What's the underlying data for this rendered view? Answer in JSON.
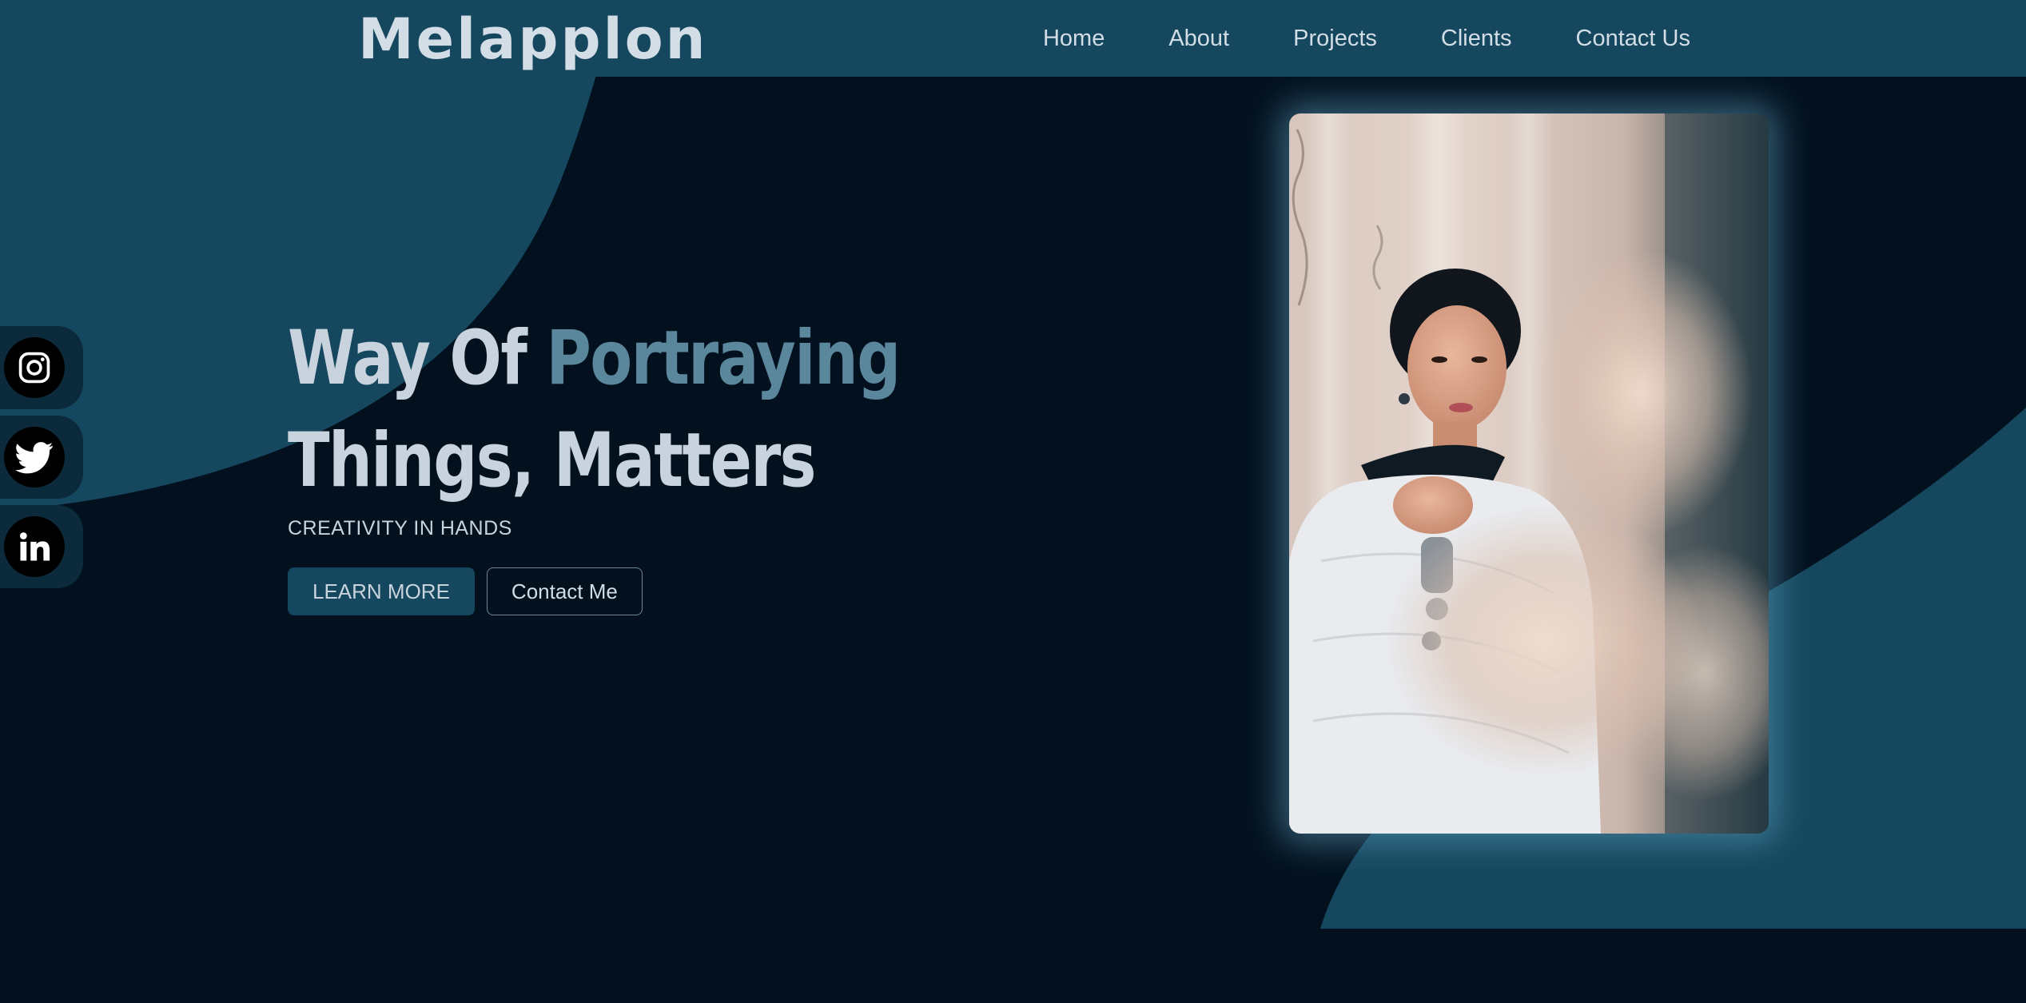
{
  "brand": {
    "logo_text": "Melapplon"
  },
  "nav": {
    "items": [
      "Home",
      "About",
      "Projects",
      "Clients",
      "Contact Us"
    ]
  },
  "social": {
    "items": [
      {
        "name": "instagram-icon"
      },
      {
        "name": "twitter-icon"
      },
      {
        "name": "linkedin-icon"
      }
    ]
  },
  "hero": {
    "headline_part1": "Way Of ",
    "headline_accent": "Portraying",
    "headline_line2": "Things, Matters",
    "tagline": "CREATIVITY IN HANDS",
    "primary_button": "LEARN MORE",
    "secondary_button": "Contact Me"
  },
  "colors": {
    "background": "#03111f",
    "navbar": "#15475e",
    "accent_shape": "#15475e",
    "headline_text": "#c8d3de",
    "headline_accent": "#5b879c"
  }
}
